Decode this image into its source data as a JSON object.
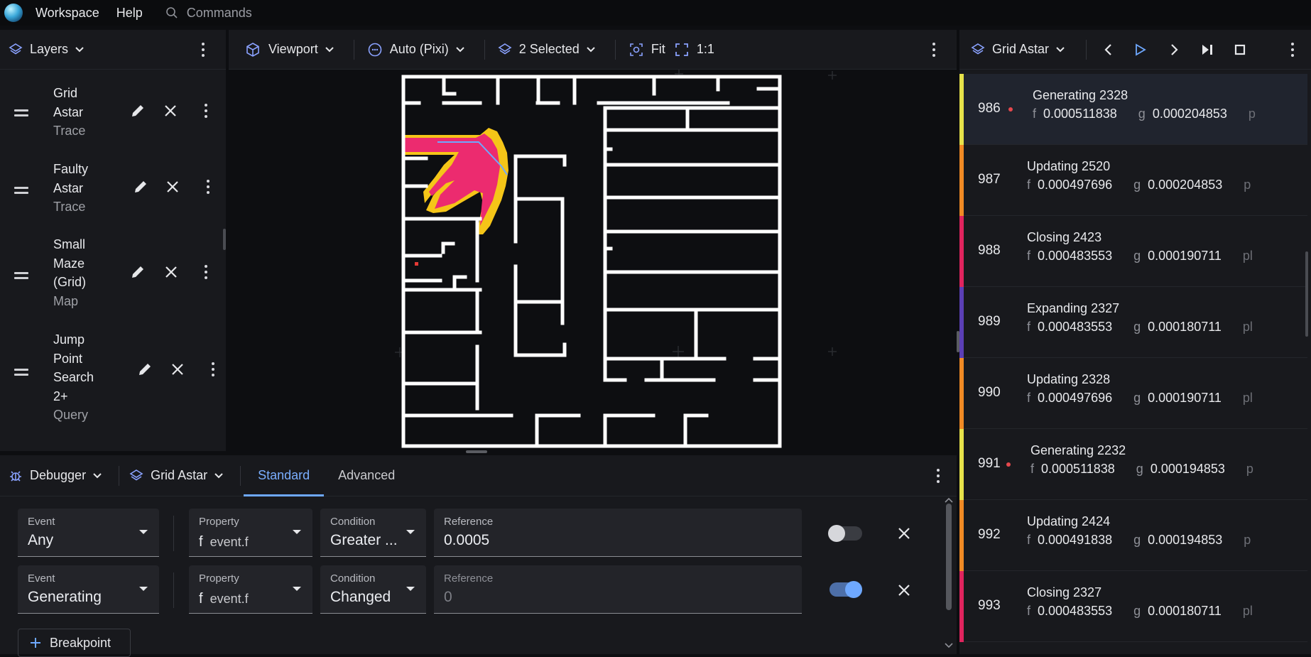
{
  "topbar": {
    "menu": [
      "Workspace",
      "Help"
    ],
    "command_placeholder": "Commands"
  },
  "layers_panel": {
    "title": "Layers",
    "items": [
      {
        "name_lines": [
          "Grid",
          "Astar"
        ],
        "type": "Trace"
      },
      {
        "name_lines": [
          "Faulty",
          "Astar"
        ],
        "type": "Trace"
      },
      {
        "name_lines": [
          "Small",
          "Maze",
          "(Grid)"
        ],
        "type": "Map"
      },
      {
        "name_lines": [
          "Jump",
          "Point",
          "Search",
          "2+"
        ],
        "type": "Query"
      }
    ]
  },
  "viewport_toolbar": {
    "viewport_label": "Viewport",
    "renderer_label": "Auto (Pixi)",
    "selection_label": "2 Selected",
    "fit_label": "Fit",
    "zoom_label": "1:1"
  },
  "trace_panel": {
    "title": "Grid Astar",
    "rows": [
      {
        "step": "986",
        "event": "Generating 2328",
        "f": "0.000511838",
        "g": "0.000204853",
        "cut": "p",
        "breakpoint": true,
        "selected": true,
        "color": "#e6e24a"
      },
      {
        "step": "987",
        "event": "Updating 2520",
        "f": "0.000497696",
        "g": "0.000204853",
        "cut": "p",
        "breakpoint": false,
        "selected": false,
        "color": "#f08a24"
      },
      {
        "step": "988",
        "event": "Closing 2423",
        "f": "0.000483553",
        "g": "0.000190711",
        "cut": "pl",
        "breakpoint": false,
        "selected": false,
        "color": "#e0245e"
      },
      {
        "step": "989",
        "event": "Expanding 2327",
        "f": "0.000483553",
        "g": "0.000180711",
        "cut": "pl",
        "breakpoint": false,
        "selected": false,
        "color": "#5b3fb5"
      },
      {
        "step": "990",
        "event": "Updating 2328",
        "f": "0.000497696",
        "g": "0.000190711",
        "cut": "pl",
        "breakpoint": false,
        "selected": false,
        "color": "#f08a24"
      },
      {
        "step": "991",
        "event": "Generating 2232",
        "f": "0.000511838",
        "g": "0.000194853",
        "cut": "p",
        "breakpoint": true,
        "selected": false,
        "color": "#e6e24a"
      },
      {
        "step": "992",
        "event": "Updating 2424",
        "f": "0.000491838",
        "g": "0.000194853",
        "cut": "p",
        "breakpoint": false,
        "selected": false,
        "color": "#f08a24"
      },
      {
        "step": "993",
        "event": "Closing 2327",
        "f": "0.000483553",
        "g": "0.000180711",
        "cut": "pl",
        "breakpoint": false,
        "selected": false,
        "color": "#e0245e"
      }
    ]
  },
  "debugger": {
    "title": "Debugger",
    "trace": "Grid Astar",
    "tabs": [
      "Standard",
      "Advanced"
    ],
    "active_tab": "Standard",
    "breakpoints": [
      {
        "event_label": "Event",
        "event": "Any",
        "property_label": "Property",
        "property_prefix": "f",
        "property": "event.f",
        "condition_label": "Condition",
        "condition": "Greater ...",
        "reference_label": "Reference",
        "reference": "0.0005",
        "enabled": false
      },
      {
        "event_label": "Event",
        "event": "Generating",
        "property_label": "Property",
        "property_prefix": "f",
        "property": "event.f",
        "condition_label": "Condition",
        "condition": "Changed",
        "reference_label": "Reference",
        "reference_placeholder": "0",
        "enabled": true
      }
    ],
    "add_button": "Breakpoint"
  },
  "colors": {
    "accent": "#6ea8ff",
    "highlight": "#ec2b6f",
    "frontier": "#f5c518",
    "wall": "#ffffff"
  }
}
